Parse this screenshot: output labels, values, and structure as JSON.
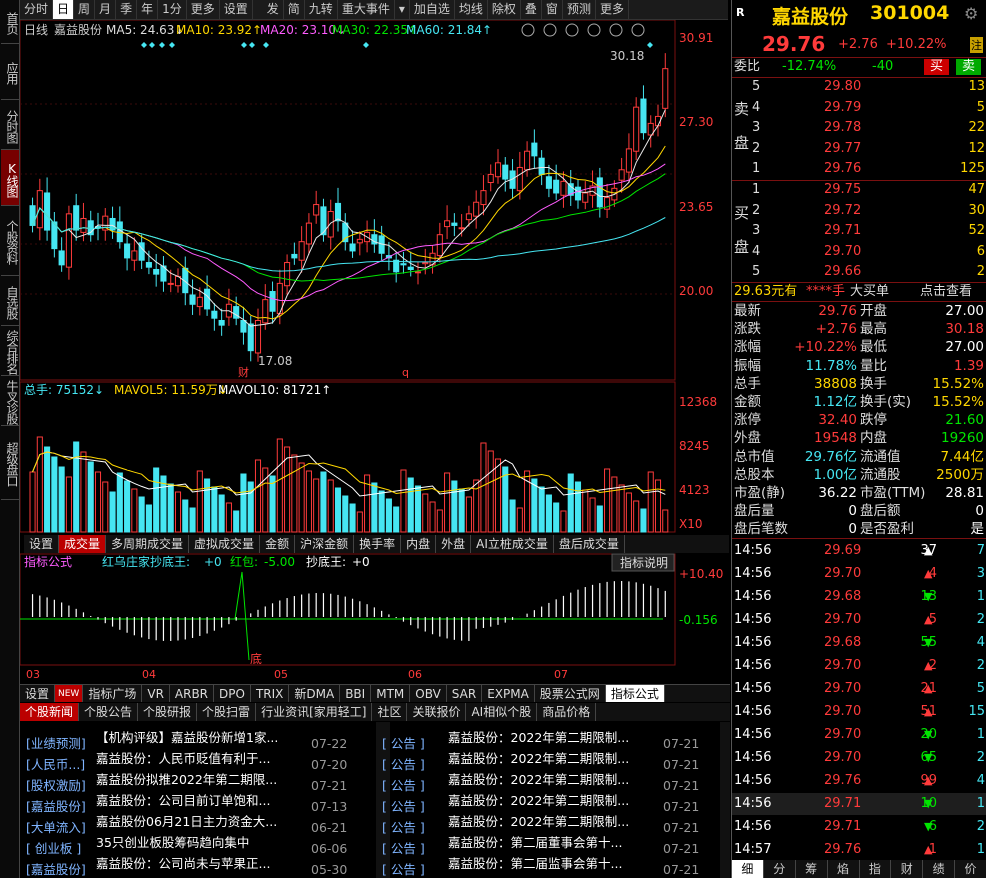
{
  "left_tabs": [
    "首页",
    "应用",
    "分时图",
    "K线图",
    "个股资料",
    "自选股",
    "综合排名",
    "牛叉诊股",
    "超级盘口"
  ],
  "left_tab_active": 3,
  "toolbar": [
    "分时",
    "日",
    "周",
    "月",
    "季",
    "年",
    "1分",
    "更多",
    "设置",
    "发",
    "简",
    "九转",
    "重大事件",
    "▾",
    "加自选",
    "均线",
    "除权",
    "叠",
    "窗",
    "预测",
    "更多"
  ],
  "toolbar_active": 1,
  "kline": {
    "title": "日线",
    "stock": "嘉益股份",
    "ma5": "MA5: 24.63↓",
    "ma10": "MA10: 23.92↑",
    "ma20": "MA20: 23.10↓",
    "ma30": "MA30: 22.35↑",
    "ma60": "MA60: 21.84↑",
    "y_ticks": [
      "30.91",
      "27.30",
      "23.65",
      "20.00"
    ],
    "high_label": "30.18",
    "low_label": "17.08",
    "marker_cai": "财",
    "marker_q": "q"
  },
  "volume": {
    "title": "总手: 75152↓",
    "mavol5": "MAVOL5: 11.59万↓",
    "mavol10": "MAVOL10: 81721↑",
    "y_ticks": [
      "12368",
      "8245",
      "4123",
      "X10"
    ]
  },
  "vol_tabs": [
    "设置",
    "成交量",
    "多周期成交量",
    "虚拟成交量",
    "金额",
    "沪深金额",
    "换手率",
    "内盘",
    "外盘",
    "AI立桩成交量",
    "盘后成交量"
  ],
  "vol_tab_active": 1,
  "indicator": {
    "title": "指标公式",
    "name": "红乌庄家抄底王:",
    "v1": "+0",
    "hb_label": "红包:",
    "hb": "-5.00",
    "cd_label": "抄底王:",
    "cd": "+0",
    "explain": "指标说明",
    "y_top": "+10.40",
    "y_mid": "-0.156",
    "x_labels": [
      "03",
      "04",
      "05",
      "06",
      "07"
    ],
    "di": "底"
  },
  "ind_tabs": [
    "设置",
    "NEW",
    "指标广场",
    "VR",
    "ARBR",
    "DPO",
    "TRIX",
    "新DMA",
    "BBI",
    "MTM",
    "OBV",
    "SAR",
    "EXPMA",
    "股票公式网",
    "指标公式"
  ],
  "news_tabs": [
    "个股新闻",
    "个股公告",
    "个股研报",
    "个股扫雷",
    "行业资讯[家用轻工]",
    "社区",
    "关联报价",
    "AI相似个股",
    "商品价格"
  ],
  "news_left": [
    {
      "tag": "[业绩预测]",
      "text": "【机构评级】嘉益股份新增1家...",
      "date": "07-22"
    },
    {
      "tag": "[人民币...]",
      "text": "嘉益股份：人民币贬值有利于...",
      "date": "07-20"
    },
    {
      "tag": "[股权激励]",
      "text": "嘉益股份拟推2022年第二期限...",
      "date": "07-21"
    },
    {
      "tag": "[嘉益股份]",
      "text": "嘉益股份：公司目前订单饱和...",
      "date": "07-13"
    },
    {
      "tag": "[大单流入]",
      "text": "嘉益股份06月21日主力资金大...",
      "date": "06-21"
    },
    {
      "tag": "[ 创业板 ]",
      "text": "35只创业板股筹码趋向集中",
      "date": "06-06"
    },
    {
      "tag": "[嘉益股份]",
      "text": "嘉益股份：公司尚未与苹果正...",
      "date": "05-30"
    }
  ],
  "news_right": [
    {
      "tag": "[  公告  ]",
      "text": "嘉益股份：2022年第二期限制...",
      "date": "07-21"
    },
    {
      "tag": "[  公告  ]",
      "text": "嘉益股份：2022年第二期限制...",
      "date": "07-21"
    },
    {
      "tag": "[  公告  ]",
      "text": "嘉益股份：2022年第二期限制...",
      "date": "07-21"
    },
    {
      "tag": "[  公告  ]",
      "text": "嘉益股份：2022年第二期限制...",
      "date": "07-21"
    },
    {
      "tag": "[  公告  ]",
      "text": "嘉益股份：2022年第二期限制...",
      "date": "07-21"
    },
    {
      "tag": "[  公告  ]",
      "text": "嘉益股份：第二届董事会第十...",
      "date": "07-21"
    },
    {
      "tag": "[  公告  ]",
      "text": "嘉益股份：第二届监事会第十...",
      "date": "07-21"
    }
  ],
  "quote": {
    "name": "嘉益股份",
    "code": "301004",
    "price": "29.76",
    "change": "+2.76",
    "pct": "+10.22%",
    "zhu": "注",
    "weibi_label": "委比",
    "weibi": "-12.74%",
    "weicha": "-40",
    "buy": "买",
    "sell": "卖",
    "sell_levels": [
      {
        "lv": "5",
        "p": "29.80",
        "v": "13"
      },
      {
        "lv": "4",
        "p": "29.79",
        "v": "5"
      },
      {
        "lv": "3",
        "p": "29.78",
        "v": "22"
      },
      {
        "lv": "2",
        "p": "29.77",
        "v": "12"
      },
      {
        "lv": "1",
        "p": "29.76",
        "v": "125"
      }
    ],
    "buy_levels": [
      {
        "lv": "1",
        "p": "29.75",
        "v": "47"
      },
      {
        "lv": "2",
        "p": "29.72",
        "v": "30"
      },
      {
        "lv": "3",
        "p": "29.71",
        "v": "52"
      },
      {
        "lv": "4",
        "p": "29.70",
        "v": "6"
      },
      {
        "lv": "5",
        "p": "29.66",
        "v": "2"
      }
    ],
    "sell_side": "卖盘",
    "buy_side": "买盘",
    "big": {
      "price": "29.63元有",
      "stars": "****手",
      "label": "大买单",
      "link": "点击查看"
    },
    "stats": [
      {
        "l": "最新",
        "lv": "29.76",
        "r": "开盘",
        "rv": "27.00"
      },
      {
        "l": "涨跌",
        "lv": "+2.76",
        "r": "最高",
        "rv": "30.18"
      },
      {
        "l": "涨幅",
        "lv": "+10.22%",
        "r": "最低",
        "rv": "27.00"
      },
      {
        "l": "振幅",
        "lv": "11.78%",
        "r": "量比",
        "rv": "1.39"
      },
      {
        "l": "总手",
        "lv": "38808",
        "r": "换手",
        "rv": "15.52%"
      },
      {
        "l": "金额",
        "lv": "1.12亿",
        "r": "换手(实)",
        "rv": "15.52%"
      },
      {
        "l": "涨停",
        "lv": "32.40",
        "r": "跌停",
        "rv": "21.60"
      },
      {
        "l": "外盘",
        "lv": "19548",
        "r": "内盘",
        "rv": "19260"
      },
      {
        "l": "总市值",
        "lv": "29.76亿",
        "r": "流通值",
        "rv": "7.44亿"
      },
      {
        "l": "总股本",
        "lv": "1.00亿",
        "r": "流通股",
        "rv": "2500万"
      },
      {
        "l": "市盈(静)",
        "lv": "36.22",
        "r": "市盈(TTM)",
        "rv": "28.81"
      },
      {
        "l": "盘后量",
        "lv": "0",
        "r": "盘后额",
        "rv": "0"
      },
      {
        "l": "盘后笔数",
        "lv": "0",
        "r": "是否盈利",
        "rv": "是"
      }
    ],
    "ticks": [
      {
        "t": "14:56",
        "p": "29.69",
        "v": "37",
        "d": "up-w",
        "n": "7"
      },
      {
        "t": "14:56",
        "p": "29.70",
        "v": "4",
        "d": "up",
        "n": "3"
      },
      {
        "t": "14:56",
        "p": "29.68",
        "v": "13",
        "d": "down",
        "n": "1"
      },
      {
        "t": "14:56",
        "p": "29.70",
        "v": "5",
        "d": "up",
        "n": "2"
      },
      {
        "t": "14:56",
        "p": "29.68",
        "v": "55",
        "d": "down",
        "n": "4"
      },
      {
        "t": "14:56",
        "p": "29.70",
        "v": "2",
        "d": "up",
        "n": "2"
      },
      {
        "t": "14:56",
        "p": "29.70",
        "v": "21",
        "d": "up",
        "n": "5"
      },
      {
        "t": "14:56",
        "p": "29.70",
        "v": "51",
        "d": "up",
        "n": "15"
      },
      {
        "t": "14:56",
        "p": "29.70",
        "v": "20",
        "d": "down",
        "n": "1"
      },
      {
        "t": "14:56",
        "p": "29.70",
        "v": "65",
        "d": "down",
        "n": "2"
      },
      {
        "t": "14:56",
        "p": "29.76",
        "v": "99",
        "d": "up",
        "n": "4"
      },
      {
        "t": "14:56",
        "p": "29.71",
        "v": "10",
        "d": "down",
        "n": "1"
      },
      {
        "t": "14:56",
        "p": "29.71",
        "v": "6",
        "d": "down",
        "n": "2"
      },
      {
        "t": "14:57",
        "p": "29.76",
        "v": "1",
        "d": "up",
        "n": "1"
      }
    ],
    "bottom_tabs": [
      "细",
      "分",
      "筹",
      "焰",
      "指",
      "财",
      "绩",
      "价"
    ]
  },
  "colors": {
    "up": "#ff3b3b",
    "down": "#00e500",
    "cyan": "#46e6f2",
    "yellow": "#ffd700",
    "grid": "#7a1010"
  }
}
